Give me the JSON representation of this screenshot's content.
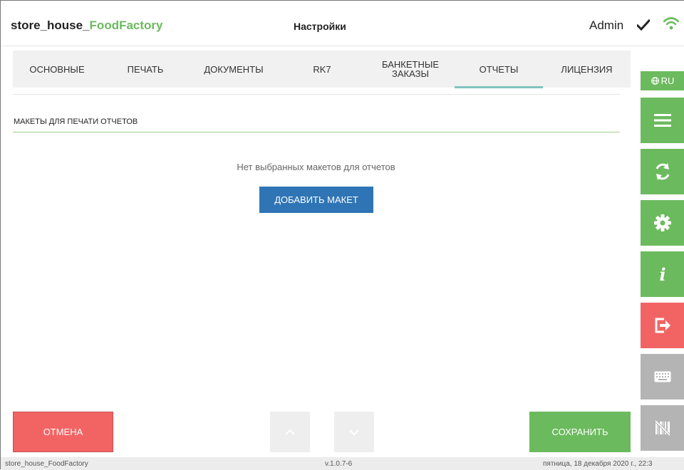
{
  "header": {
    "app_name_prefix": "store_house_",
    "app_name_accent": "FoodFactory",
    "page_title": "Настройки",
    "user": "Admin",
    "icons": [
      "check-icon",
      "wifi-icon"
    ]
  },
  "tabs": [
    {
      "label": "ОСНОВНЫЕ",
      "active": false
    },
    {
      "label": "ПЕЧАТЬ",
      "active": false
    },
    {
      "label": "ДОКУМЕНТЫ",
      "active": false
    },
    {
      "label": "RK7",
      "active": false
    },
    {
      "label": "БАНКЕТНЫЕ\nЗАКАЗЫ",
      "active": false
    },
    {
      "label": "ОТЧЕТЫ",
      "active": true
    },
    {
      "label": "ЛИЦЕНЗИЯ",
      "active": false
    }
  ],
  "section": {
    "title": "МАКЕТЫ ДЛЯ ПЕЧАТИ ОТЧЕТОВ",
    "empty_message": "Нет выбранных макетов для отчетов",
    "add_button": "ДОБАВИТЬ МАКЕТ"
  },
  "sidebar": {
    "language": "RU",
    "buttons": [
      "menu-icon",
      "sync-icon",
      "gear-icon",
      "info-icon",
      "logout-icon",
      "keyboard-icon",
      "barcode-off-icon"
    ]
  },
  "footer": {
    "cancel": "ОТМЕНА",
    "save": "СОХРАНИТЬ",
    "nav": [
      "chevron-up-icon",
      "chevron-down-icon"
    ]
  },
  "statusbar": {
    "app": "store_house_FoodFactory",
    "version": "v.1.0.7-6",
    "datetime": "пятница, 18 декабря 2020 г., 22:3"
  },
  "colors": {
    "green": "#6cba5e",
    "red": "#f26464",
    "blue": "#2f75b5",
    "teal_underline": "#7fc4bd",
    "gray": "#b4b4b4"
  }
}
